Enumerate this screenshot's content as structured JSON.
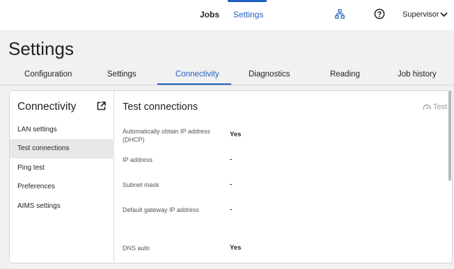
{
  "topnav": {
    "jobs": "Jobs",
    "settings": "Settings",
    "user": "Supervisor"
  },
  "page": {
    "title": "Settings"
  },
  "tabs": [
    {
      "label": "Configuration"
    },
    {
      "label": "Settings"
    },
    {
      "label": "Connectivity"
    },
    {
      "label": "Diagnostics"
    },
    {
      "label": "Reading"
    },
    {
      "label": "Job history"
    }
  ],
  "sidebar": {
    "title": "Connectivity",
    "items": [
      {
        "label": "LAN settings"
      },
      {
        "label": "Test connections"
      },
      {
        "label": "Ping test"
      },
      {
        "label": "Preferences"
      },
      {
        "label": "AIMS settings"
      }
    ]
  },
  "content": {
    "title": "Test connections",
    "test_button": "Test",
    "rows": [
      {
        "label": "Automatically obtain IP address (DHCP)",
        "value": "Yes"
      },
      {
        "label": "IP address",
        "value": "-"
      },
      {
        "label": "Subnet mask",
        "value": "-"
      },
      {
        "label": "Default gateway IP address",
        "value": "-"
      },
      {
        "label": "DNS auto",
        "value": "Yes"
      }
    ]
  },
  "colors": {
    "accent": "#1f5fbf",
    "background": "#f1f1f1",
    "selected_item": "#e8e8e8",
    "disabled_text": "#9a9a9a"
  },
  "icons": {
    "network": "network-topology-icon",
    "help": "help-icon",
    "user_menu": "chevron-down-icon",
    "open_external": "external-link-icon",
    "test": "speedometer-icon"
  }
}
